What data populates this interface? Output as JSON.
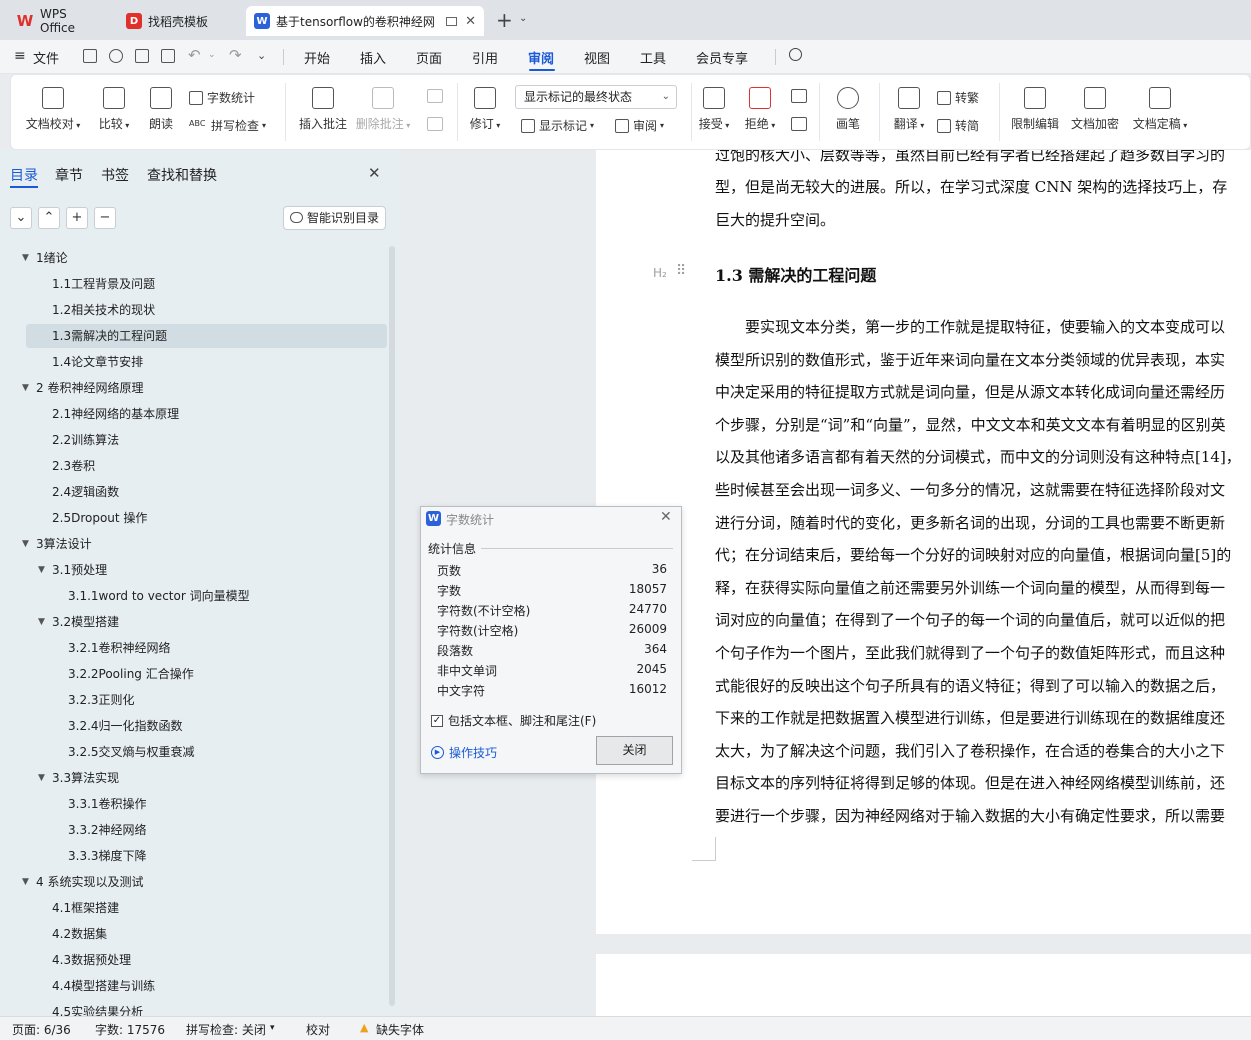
{
  "tabs": [
    {
      "label": "WPS Office"
    },
    {
      "label": "找稻壳模板"
    },
    {
      "label": "基于tensorflow的卷积神经网"
    }
  ],
  "menu": {
    "file": "文件",
    "items": [
      "开始",
      "插入",
      "页面",
      "引用",
      "审阅",
      "视图",
      "工具",
      "会员专享"
    ],
    "active": "审阅"
  },
  "ribbon": {
    "doc_check": "文档校对",
    "compare": "比较",
    "read_aloud": "朗读",
    "word_count": "字数统计",
    "spell_check": "拼写检查",
    "insert_comment": "插入批注",
    "delete_comment": "删除批注",
    "revise": "修订",
    "display_select": "显示标记的最终状态",
    "show_markup": "显示标记",
    "review_pane": "审阅",
    "accept": "接受",
    "reject": "拒绝",
    "pen": "画笔",
    "translate": "翻译",
    "to_traditional": "转繁",
    "to_simplified": "转简",
    "restrict_edit": "限制编辑",
    "encrypt": "文档加密",
    "finalize": "文档定稿"
  },
  "panel": {
    "tabs": [
      "目录",
      "章节",
      "书签",
      "查找和替换"
    ],
    "smart_toc": "智能识别目录",
    "toc": [
      {
        "level": 1,
        "text": "1绪论",
        "expanded": true
      },
      {
        "level": 2,
        "text": "1.1工程背景及问题"
      },
      {
        "level": 2,
        "text": "1.2相关技术的现状"
      },
      {
        "level": 2,
        "text": "1.3需解决的工程问题",
        "selected": true
      },
      {
        "level": 2,
        "text": "1.4论文章节安排"
      },
      {
        "level": 1,
        "text": "2 卷积神经网络原理",
        "expanded": true
      },
      {
        "level": 2,
        "text": "2.1神经网络的基本原理"
      },
      {
        "level": 2,
        "text": "2.2训练算法"
      },
      {
        "level": 2,
        "text": "2.3卷积"
      },
      {
        "level": 2,
        "text": "2.4逻辑函数"
      },
      {
        "level": 2,
        "text": "2.5Dropout 操作"
      },
      {
        "level": 1,
        "text": "3算法设计",
        "expanded": true
      },
      {
        "level": 2,
        "text": "3.1预处理",
        "expanded": true
      },
      {
        "level": 3,
        "text": "3.1.1word to vector 词向量模型"
      },
      {
        "level": 2,
        "text": "3.2模型搭建",
        "expanded": true
      },
      {
        "level": 3,
        "text": "3.2.1卷积神经网络"
      },
      {
        "level": 3,
        "text": "3.2.2Pooling 汇合操作"
      },
      {
        "level": 3,
        "text": "3.2.3正则化"
      },
      {
        "level": 3,
        "text": "3.2.4归一化指数函数"
      },
      {
        "level": 3,
        "text": "3.2.5交叉熵与权重衰减"
      },
      {
        "level": 2,
        "text": "3.3算法实现",
        "expanded": true
      },
      {
        "level": 3,
        "text": "3.3.1卷积操作"
      },
      {
        "level": 3,
        "text": "3.3.2神经网络"
      },
      {
        "level": 3,
        "text": "3.3.3梯度下降"
      },
      {
        "level": 1,
        "text": "4 系统实现以及测试",
        "expanded": true
      },
      {
        "level": 2,
        "text": "4.1框架搭建"
      },
      {
        "level": 2,
        "text": "4.2数据集"
      },
      {
        "level": 2,
        "text": "4.3数据预处理"
      },
      {
        "level": 2,
        "text": "4.4模型搭建与训练"
      },
      {
        "level": 2,
        "text": "4.5实验结果分析"
      }
    ]
  },
  "document": {
    "top_line": "过饱的核大小、层数等等，虽然目前已经有学者已经搭建起了趋多数目学习的",
    "lines_a": [
      "型，但是尚无较大的进展。所以，在学习式深度 CNN 架构的选择技巧上，存",
      "巨大的提升空间。"
    ],
    "heading_marker": "H₂",
    "heading": "1.3 需解决的工程问题",
    "lines_b": [
      "　　要实现文本分类，第一步的工作就是提取特征，使要输入的文本变成可以",
      "模型所识别的数值形式，鉴于近年来词向量在文本分类领域的优异表现，本实",
      "中决定采用的特征提取方式就是词向量，但是从源文本转化成词向量还需经历",
      "个步骤，分别是“词”和“向量”，显然，中文文本和英文文本有着明显的区别英",
      "以及其他诸多语言都有着天然的分词模式，而中文的分词则没有这种特点[14]，",
      "些时候甚至会出现一词多义、一句多分的情况，这就需要在特征选择阶段对文",
      "进行分词，随着时代的变化，更多新名词的出现，分词的工具也需要不断更新",
      "代；在分词结束后，要给每一个分好的词映射对应的向量值，根据词向量[5]的",
      "释，在获得实际向量值之前还需要另外训练一个词向量的模型，从而得到每一",
      "词对应的向量值；在得到了一个句子的每一个词的向量值后，就可以近似的把",
      "个句子作为一个图片，至此我们就得到了一个句子的数值矩阵形式，而且这种",
      "式能很好的反映出这个句子所具有的语义特征；得到了可以输入的数据之后，",
      "下来的工作就是把数据置入模型进行训练，但是要进行训练现在的数据维度还",
      "太大，为了解决这个问题，我们引入了卷积操作，在合适的卷集合的大小之下",
      "目标文本的序列特征将得到足够的体现。但是在进入神经网络模型训练前，还",
      "要进行一个步骤，因为神经网络对于输入数据的大小有确定性要求，所以需要"
    ]
  },
  "dialog": {
    "title": "字数统计",
    "section": "统计信息",
    "rows": [
      {
        "label": "页数",
        "value": "36"
      },
      {
        "label": "字数",
        "value": "18057"
      },
      {
        "label": "字符数(不计空格)",
        "value": "24770"
      },
      {
        "label": "字符数(计空格)",
        "value": "26009"
      },
      {
        "label": "段落数",
        "value": "364"
      },
      {
        "label": "非中文单词",
        "value": "2045"
      },
      {
        "label": "中文字符",
        "value": "16012"
      }
    ],
    "checkbox": "包括文本框、脚注和尾注(F)",
    "tips": "操作技巧",
    "close": "关闭"
  },
  "status": {
    "page": "页面: 6/36",
    "words": "字数: 17576",
    "spell": "拼写检查: 关闭",
    "proof": "校对",
    "missing_font": "缺失字体"
  },
  "colors": {
    "accent": "#1a5ad6",
    "wps_red": "#e0302b",
    "doc_blue": "#2b62d9",
    "panel_bg": "#e6eef1",
    "warn": "#f0a020"
  }
}
